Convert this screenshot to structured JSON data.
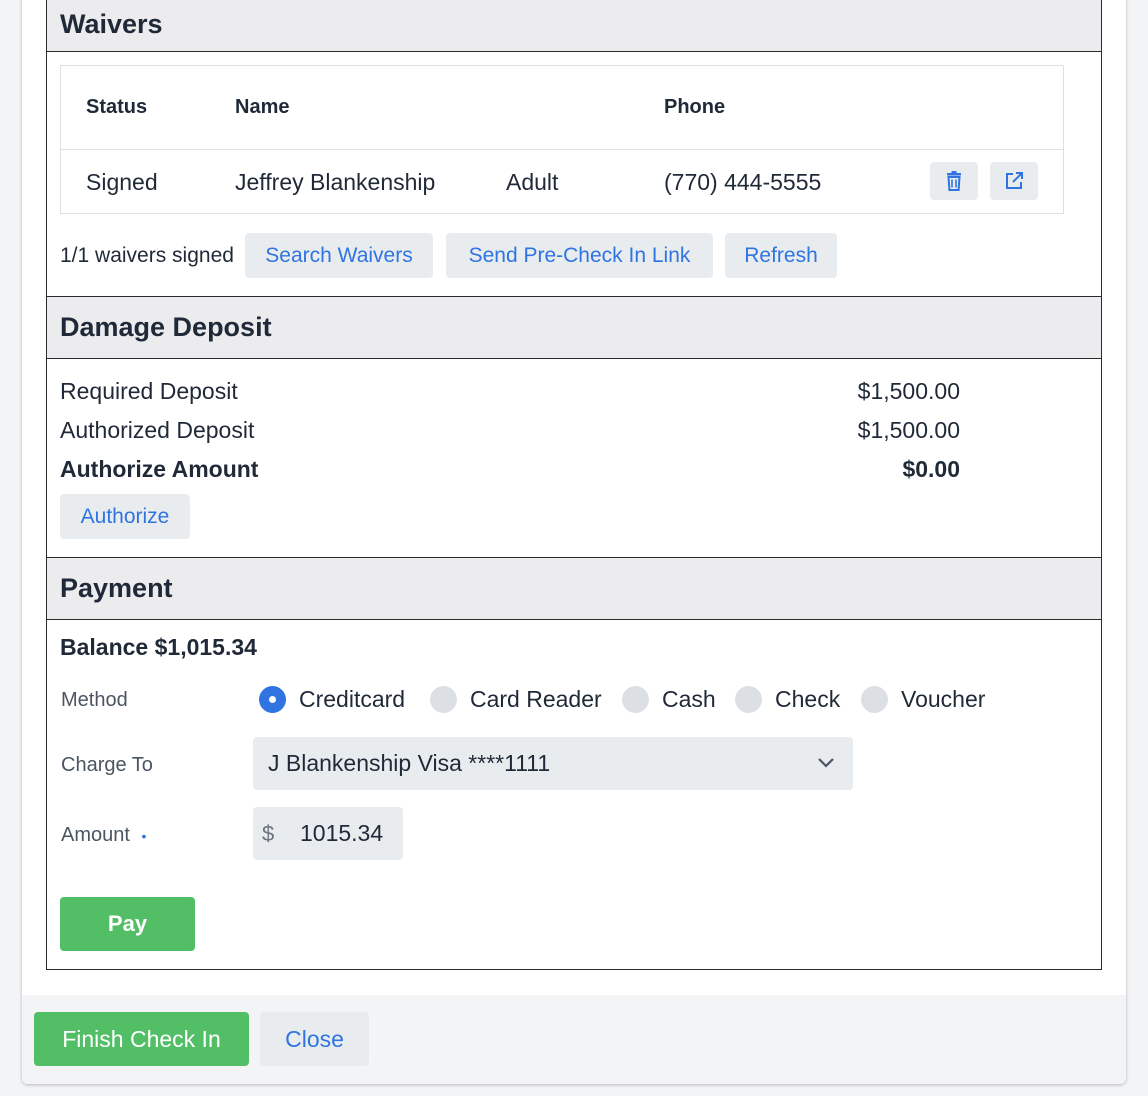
{
  "waivers": {
    "title": "Waivers",
    "columns": {
      "status": "Status",
      "name": "Name",
      "phone": "Phone"
    },
    "rows": [
      {
        "status": "Signed",
        "name": "Jeffrey Blankenship",
        "type": "Adult",
        "phone": "(770) 444-5555"
      }
    ],
    "summary": "1/1 waivers signed",
    "actions": {
      "search": "Search Waivers",
      "send_link": "Send Pre-Check In Link",
      "refresh": "Refresh"
    }
  },
  "damage_deposit": {
    "title": "Damage Deposit",
    "required_label": "Required Deposit",
    "required_value": "$1,500.00",
    "authorized_label": "Authorized Deposit",
    "authorized_value": "$1,500.00",
    "authorize_amount_label": "Authorize Amount",
    "authorize_amount_value": "$0.00",
    "authorize_button": "Authorize"
  },
  "payment": {
    "title": "Payment",
    "balance": "Balance $1,015.34",
    "method_label": "Method",
    "methods": [
      "Creditcard",
      "Card Reader",
      "Cash",
      "Check",
      "Voucher"
    ],
    "selected_method": "Creditcard",
    "charge_to_label": "Charge To",
    "charge_to_value": "J Blankenship Visa ****1111",
    "amount_label": "Amount",
    "required_marker": "•",
    "currency_symbol": "$",
    "amount_value": "1015.34",
    "pay_button": "Pay"
  },
  "footer": {
    "finish_button": "Finish Check In",
    "close_button": "Close"
  },
  "colors": {
    "accent_blue": "#2f74e0",
    "success_green": "#52bf66",
    "button_bg": "#e9ecef"
  }
}
